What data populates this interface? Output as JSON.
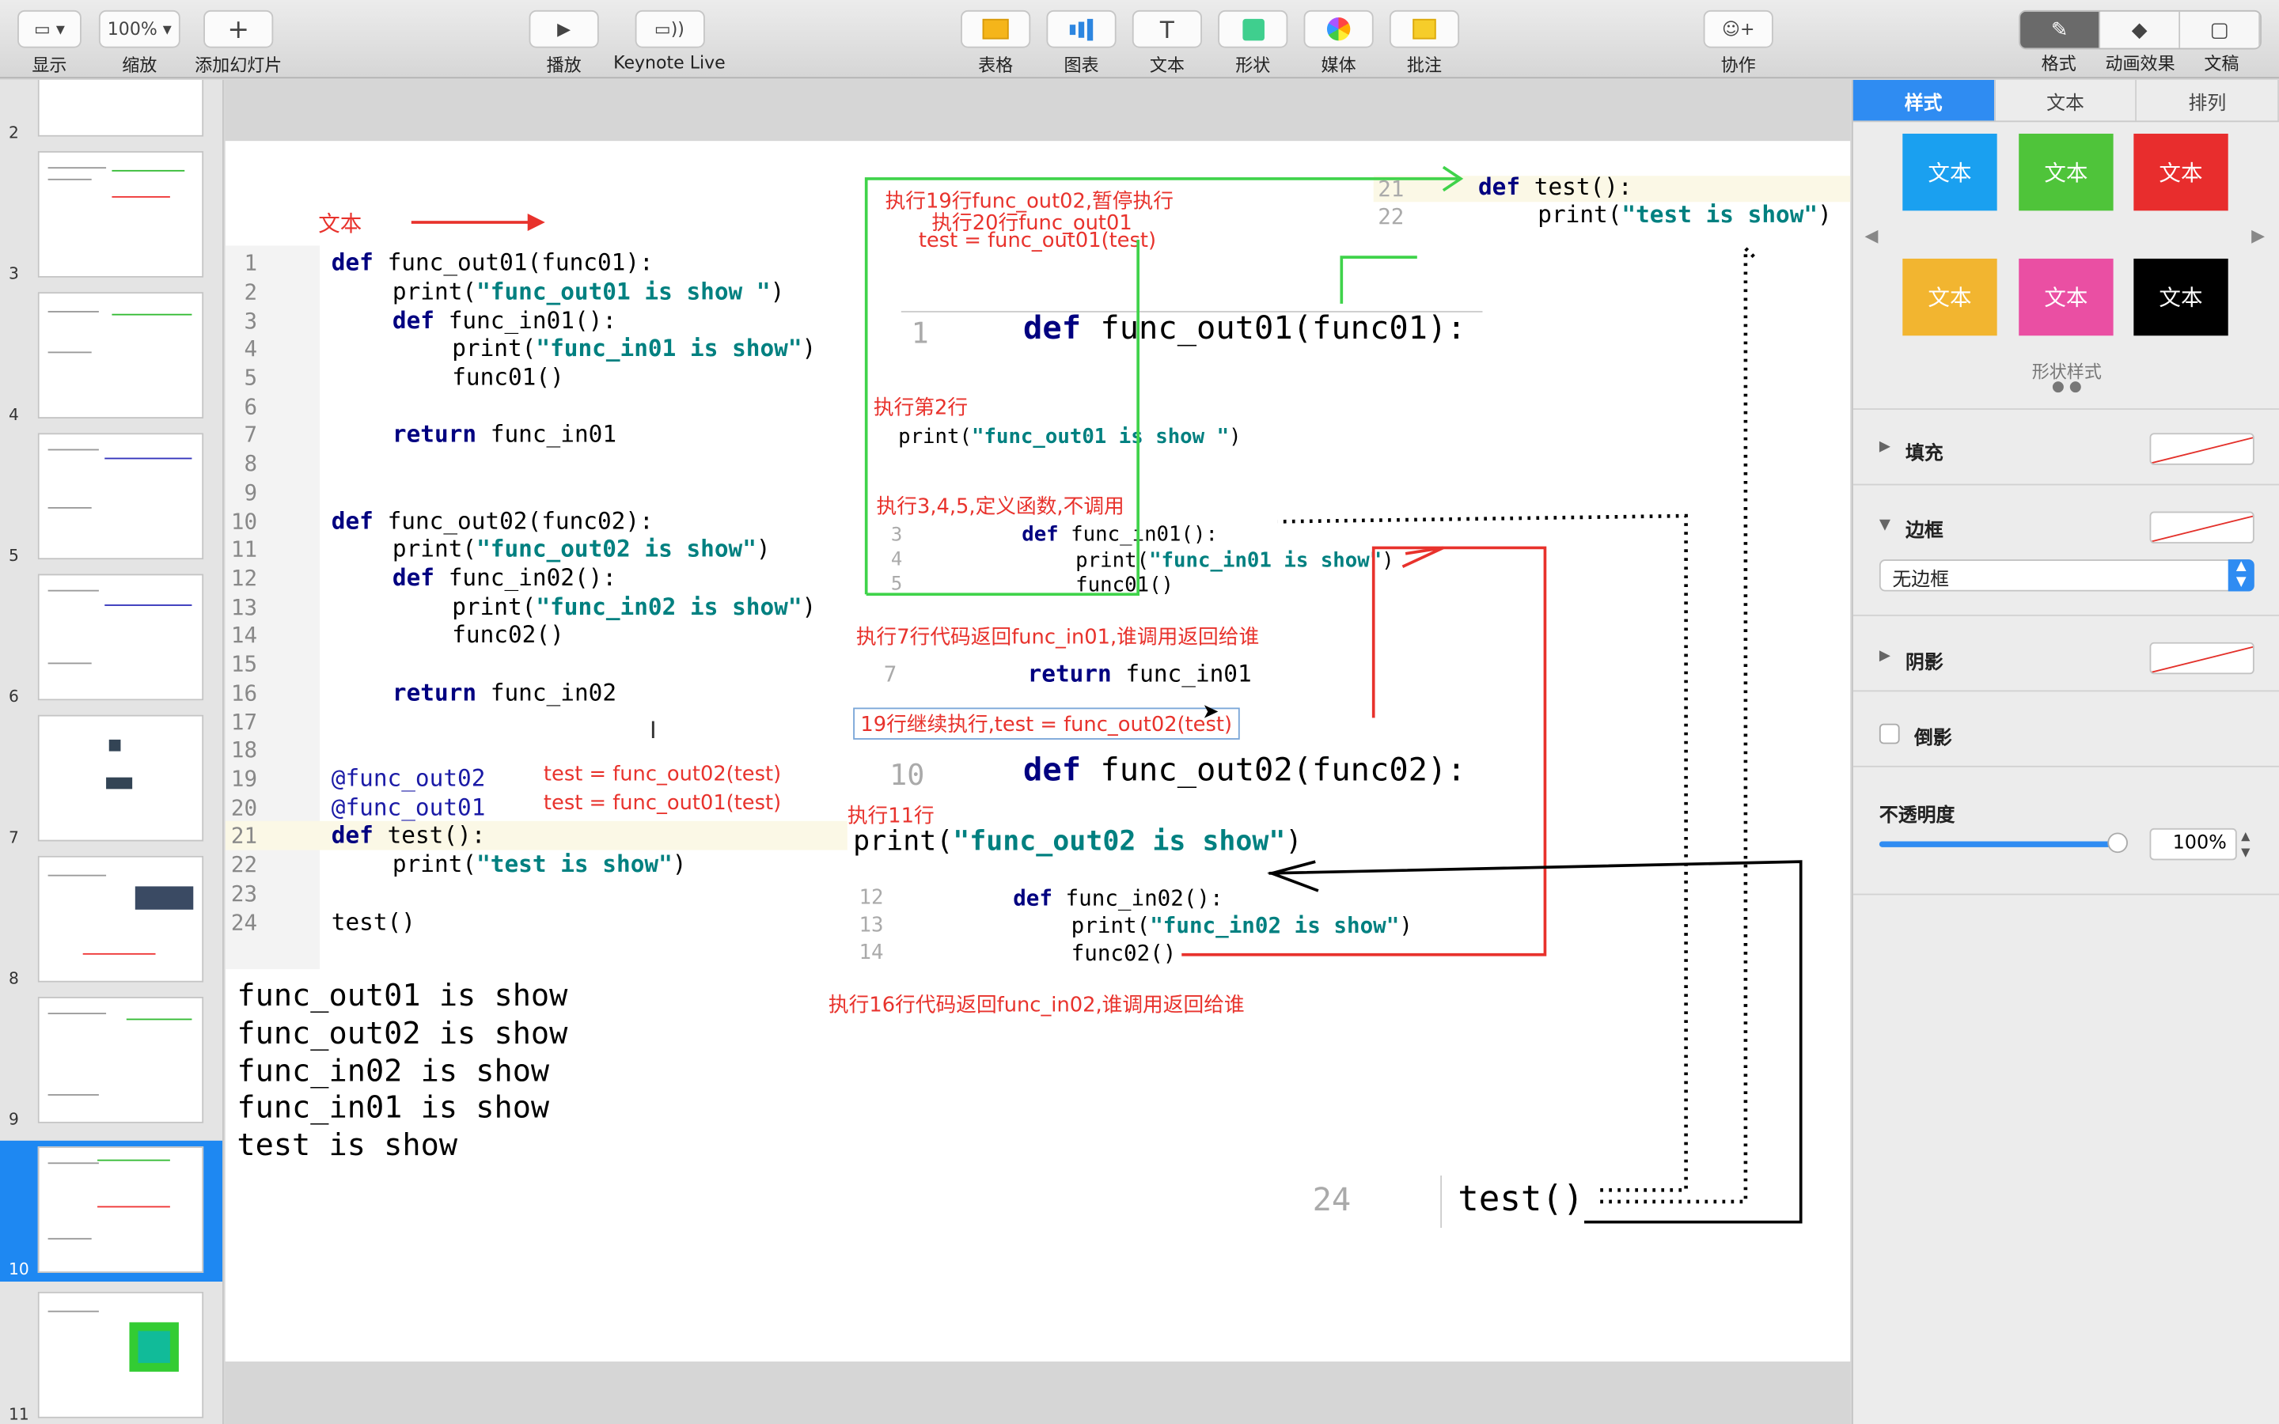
{
  "toolbar": {
    "view": "显示",
    "zoom_value": "100%",
    "zoom": "缩放",
    "add_slide": "添加幻灯片",
    "play": "播放",
    "keynote_live": "Keynote Live",
    "table": "表格",
    "chart": "图表",
    "text": "文本",
    "shape": "形状",
    "media": "媒体",
    "comment": "批注",
    "collaborate": "协作",
    "format": "格式",
    "animate": "动画效果",
    "document": "文稿"
  },
  "slides": {
    "numbers": [
      "2",
      "3",
      "4",
      "5",
      "6",
      "7",
      "8",
      "9",
      "10",
      "11"
    ],
    "selected": "10"
  },
  "slide": {
    "title_label": "文本",
    "line_numbers": [
      "1",
      "2",
      "3",
      "4",
      "5",
      "6",
      "7",
      "8",
      "9",
      "10",
      "11",
      "12",
      "13",
      "14",
      "15",
      "16",
      "17",
      "18",
      "19",
      "20",
      "21",
      "22",
      "23",
      "24"
    ],
    "code": {
      "l1": "func_out01(func01):",
      "l2a": "print(",
      "l2b": "\"func_out01 is show \"",
      "l2c": ")",
      "l3": "func_in01():",
      "l4a": "print(",
      "l4b": "\"func_in01 is show\"",
      "l4c": ")",
      "l5": "func01()",
      "l7": "func_in01",
      "l10": "func_out02(func02):",
      "l11a": "print(",
      "l11b": "\"func_out02 is show\"",
      "l11c": ")",
      "l12": "func_in02():",
      "l13a": "print(",
      "l13b": "\"func_in02 is show\"",
      "l13c": ")",
      "l14": "func02()",
      "l16": "func_in02",
      "l19": "@func_out02",
      "l20": "@func_out01",
      "l21": "test():",
      "l22a": "print(",
      "l22b": "\"test is show\"",
      "l22c": ")",
      "l24": "test()",
      "kw_def": "def",
      "kw_return": "return"
    },
    "decorator_notes": [
      "test = func_out02(test)",
      "test = func_out01(test)"
    ],
    "output": [
      "func_out01 is show",
      "func_out02 is show",
      "func_in02 is show",
      "func_in01 is show",
      "test is show"
    ],
    "annotations": {
      "a1": "执行19行func_out02,暂停执行",
      "a2": "执行20行func_out01",
      "a3": "test = func_out01(test)",
      "a4": "执行第2行",
      "a5": "执行3,4,5,定义函数,不调用",
      "a6": "执行7行代码返回func_in01,谁调用返回给谁",
      "a7": "19行继续执行,test = func_out02(test)",
      "a8": "执行11行",
      "a9": "执行16行代码返回func_in02,谁调用返回给谁"
    },
    "snippets": {
      "n21": "21",
      "n22": "22",
      "s21": "test():",
      "s22a": "print(",
      "s22b": "\"test is show\"",
      "s22c": ")",
      "n1": "1",
      "s1": "func_out01(func01):",
      "s2a": "print(",
      "s2b": "\"func_out01 is show \"",
      "s2c": ")",
      "n3": "3",
      "n4": "4",
      "n5": "5",
      "s3": "func_in01():",
      "s4a": "print(",
      "s4b": "\"func_in01 is show\"",
      "s4c": ")",
      "s5": "func01()",
      "n7": "7",
      "s7": "func_in01",
      "n10": "10",
      "s10": "func_out02(func02):",
      "s11a": "print(",
      "s11b": "\"func_out02 is show\"",
      "s11c": ")",
      "n12": "12",
      "n13": "13",
      "n14": "14",
      "s12": "func_in02():",
      "s13a": "print(",
      "s13b": "\"func_in02 is show\"",
      "s13c": ")",
      "s14": "func02()",
      "n24": "24",
      "s24": "test()"
    }
  },
  "inspector": {
    "tabs": [
      "样式",
      "文本",
      "排列"
    ],
    "swatch_label": "文本",
    "swatch_colors": [
      "#1aa0f0",
      "#4fc43a",
      "#e82d2d",
      "#f2b530",
      "#ea4fa3",
      "#000000"
    ],
    "shape_styles": "形状样式",
    "fill": "填充",
    "border": "边框",
    "border_value": "无边框",
    "shadow": "阴影",
    "reflection": "倒影",
    "opacity": "不透明度",
    "opacity_value": "100%",
    "opacity_level": 1.0
  },
  "colors": {
    "accent": "#1e88f2",
    "annotation_red": "#e8322c",
    "keyword": "#000080",
    "string": "#008080"
  }
}
